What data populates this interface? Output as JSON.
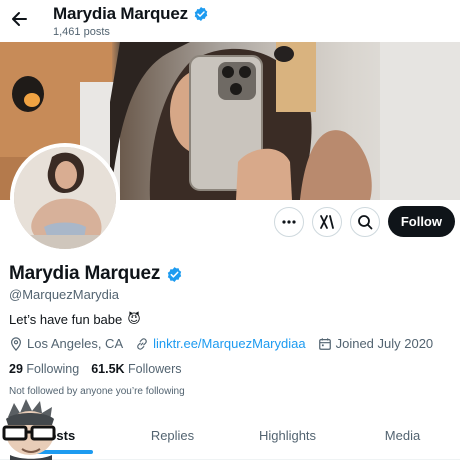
{
  "header": {
    "title": "Marydia Marquez",
    "posts_count": "1,461 posts"
  },
  "actions": {
    "follow_label": "Follow"
  },
  "profile": {
    "name": "Marydia Marquez",
    "handle": "@MarquezMarydia",
    "bio_text": "Let’s have fun babe",
    "bio_emoji": "😈",
    "location": "Los Angeles, CA",
    "link": "linktr.ee/MarquezMarydiaa",
    "joined": "Joined July 2020",
    "following_count": "29",
    "following_label": "Following",
    "followers_count": "61.5K",
    "followers_label": "Followers",
    "followed_by_note": "Not followed by anyone you’re following"
  },
  "tabs": [
    {
      "label": "Posts",
      "active": true
    },
    {
      "label": "Replies",
      "active": false
    },
    {
      "label": "Highlights",
      "active": false
    },
    {
      "label": "Media",
      "active": false
    }
  ],
  "colors": {
    "accent": "#1d9bf0",
    "text": "#0f1419",
    "muted": "#536471",
    "verified": "#1d9bf0"
  },
  "icons": {
    "back": "arrow-left-icon",
    "verified": "verified-badge-icon",
    "more": "more-dots-icon",
    "grok": "grok-icon",
    "search": "search-icon",
    "location": "location-pin-icon",
    "link": "link-icon",
    "calendar": "calendar-icon"
  }
}
